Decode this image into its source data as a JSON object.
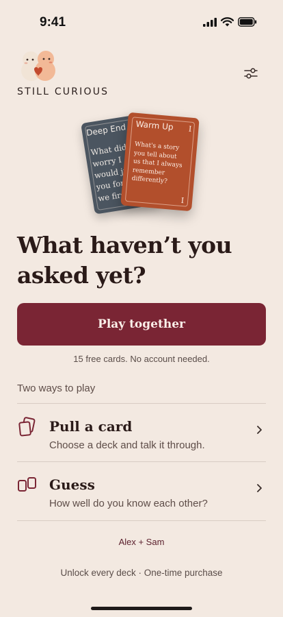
{
  "status_bar": {
    "time": "9:41"
  },
  "header": {
    "brand": "STILL CURIOUS",
    "logo_icon": "two-friends-mascot-icon",
    "settings_icon": "sliders-icon"
  },
  "hero_cards": {
    "back": {
      "deck": "Deep End",
      "question_lines": [
        "What did",
        "worry I",
        "would ju",
        "you for y",
        "we first"
      ]
    },
    "front": {
      "deck": "Warm Up",
      "numeral": "I",
      "question_lines": [
        "What's a story",
        "you tell about",
        "us that I always",
        "remember",
        "differently?"
      ]
    }
  },
  "headline": {
    "line1": "What haven’t you",
    "line2": "asked yet?"
  },
  "cta": {
    "label": "Play together",
    "note": "15 free cards. No account needed."
  },
  "modes": {
    "section_label": "Two ways to play",
    "items": [
      {
        "title": "Pull a card",
        "description": "Choose a deck and talk it through.",
        "icon": "cards-icon"
      },
      {
        "title": "Guess",
        "description": "How well do you know each other?",
        "icon": "two-cards-icon"
      }
    ]
  },
  "footer": {
    "couple": "Alex + Sam",
    "unlock": "Unlock every deck · One-time purchase"
  },
  "colors": {
    "background": "#F3E9E1",
    "accent": "#7A2534",
    "card_slate": "#4B5560",
    "card_rust": "#B24F2C"
  }
}
